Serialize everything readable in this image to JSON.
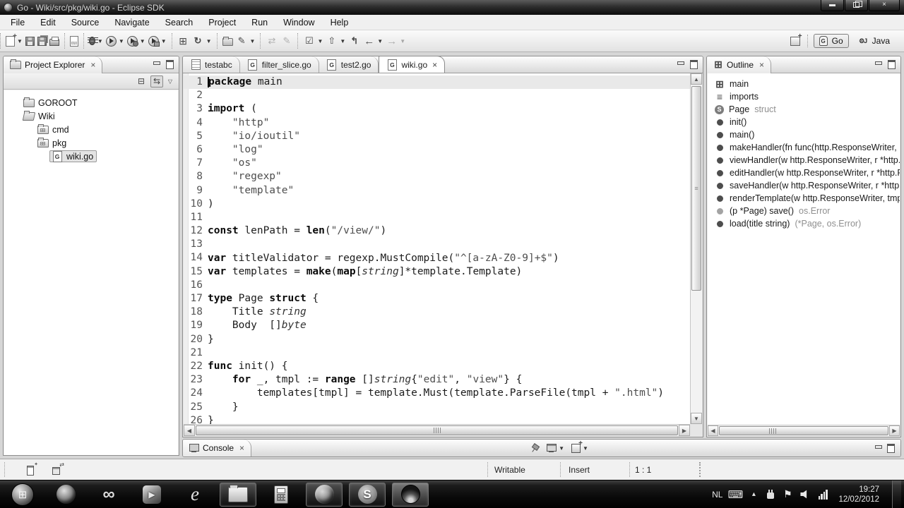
{
  "window": {
    "title": "Go - Wiki/src/pkg/wiki.go - Eclipse SDK",
    "controls": {
      "minimize": "minimize",
      "restore": "restore",
      "close": "×"
    }
  },
  "menu": [
    "File",
    "Edit",
    "Source",
    "Navigate",
    "Search",
    "Project",
    "Run",
    "Window",
    "Help"
  ],
  "toolbar": {
    "groups": [
      {
        "items": [
          {
            "icon": "new-wizard",
            "dd": true
          },
          {
            "icon": "save"
          },
          {
            "icon": "save-all"
          },
          {
            "icon": "print"
          }
        ]
      },
      {
        "items": [
          {
            "icon": "binary-file"
          }
        ]
      },
      {
        "items": [
          {
            "icon": "debug",
            "dd": true
          },
          {
            "icon": "run",
            "dd": true
          },
          {
            "icon": "run-history",
            "dd": true
          },
          {
            "icon": "run-config",
            "dd": true
          }
        ]
      },
      {
        "items": [
          {
            "icon": "build-all"
          },
          {
            "icon": "external-tools",
            "dd": true
          }
        ]
      },
      {
        "items": [
          {
            "icon": "open-resource"
          },
          {
            "icon": "mark-occurrences",
            "dd": true
          }
        ]
      },
      {
        "items": [
          {
            "icon": "refresh",
            "disabled": true
          },
          {
            "icon": "clean",
            "disabled": true
          }
        ]
      },
      {
        "items": [
          {
            "icon": "show-tasks",
            "dd": true
          },
          {
            "icon": "navigate-up",
            "dd": true
          },
          {
            "icon": "last-edit-location"
          },
          {
            "icon": "back",
            "dd": true
          },
          {
            "icon": "forward",
            "dd": true,
            "disabled": true
          }
        ]
      }
    ],
    "perspectives": [
      {
        "label": "Go",
        "icon": "go-perspective",
        "active": true
      },
      {
        "label": "Java",
        "icon": "java-perspective",
        "active": false
      }
    ]
  },
  "project_explorer": {
    "title": "Project Explorer",
    "tree": [
      {
        "label": "GOROOT",
        "icon": "folder",
        "indent": 0
      },
      {
        "label": "Wiki",
        "icon": "folder-open",
        "indent": 0
      },
      {
        "label": "cmd",
        "icon": "package-folder",
        "indent": 1
      },
      {
        "label": "pkg",
        "icon": "package-folder",
        "indent": 1
      },
      {
        "label": "wiki.go",
        "icon": "go-file",
        "indent": 2,
        "selected": true
      }
    ]
  },
  "editor": {
    "tabs": [
      {
        "label": "testabc",
        "icon": "text-file"
      },
      {
        "label": "filter_slice.go",
        "icon": "go-file"
      },
      {
        "label": "test2.go",
        "icon": "go-file"
      },
      {
        "label": "wiki.go",
        "icon": "go-file",
        "active": true,
        "close": "×"
      }
    ],
    "lines": [
      {
        "n": 1,
        "hl": true,
        "caret": true,
        "tokens": [
          [
            "package",
            "k"
          ],
          [
            " main",
            "p"
          ]
        ]
      },
      {
        "n": 2,
        "tokens": []
      },
      {
        "n": 3,
        "tokens": [
          [
            "import",
            "k"
          ],
          [
            " (",
            "p"
          ]
        ]
      },
      {
        "n": 4,
        "tokens": [
          [
            "    ",
            "p"
          ],
          [
            "\"http\"",
            "s"
          ]
        ]
      },
      {
        "n": 5,
        "tokens": [
          [
            "    ",
            "p"
          ],
          [
            "\"io/ioutil\"",
            "s"
          ]
        ]
      },
      {
        "n": 6,
        "tokens": [
          [
            "    ",
            "p"
          ],
          [
            "\"log\"",
            "s"
          ]
        ]
      },
      {
        "n": 7,
        "tokens": [
          [
            "    ",
            "p"
          ],
          [
            "\"os\"",
            "s"
          ]
        ]
      },
      {
        "n": 8,
        "tokens": [
          [
            "    ",
            "p"
          ],
          [
            "\"regexp\"",
            "s"
          ]
        ]
      },
      {
        "n": 9,
        "tokens": [
          [
            "    ",
            "p"
          ],
          [
            "\"template\"",
            "s"
          ]
        ]
      },
      {
        "n": 10,
        "tokens": [
          [
            ")",
            "p"
          ]
        ]
      },
      {
        "n": 11,
        "tokens": []
      },
      {
        "n": 12,
        "tokens": [
          [
            "const",
            "k"
          ],
          [
            " lenPath = ",
            "p"
          ],
          [
            "len",
            "k"
          ],
          [
            "(",
            "p"
          ],
          [
            "\"/view/\"",
            "s"
          ],
          [
            ")",
            "p"
          ]
        ]
      },
      {
        "n": 13,
        "tokens": []
      },
      {
        "n": 14,
        "tokens": [
          [
            "var",
            "k"
          ],
          [
            " titleValidator = regexp.MustCompile(",
            "p"
          ],
          [
            "\"^[a-zA-Z0-9]+$\"",
            "s"
          ],
          [
            ")",
            "p"
          ]
        ]
      },
      {
        "n": 15,
        "tokens": [
          [
            "var",
            "k"
          ],
          [
            " templates = ",
            "p"
          ],
          [
            "make",
            "k"
          ],
          [
            "(",
            "p"
          ],
          [
            "map",
            "k"
          ],
          [
            "[",
            "p"
          ],
          [
            "string",
            "t"
          ],
          [
            "]*template.Template)",
            "p"
          ]
        ]
      },
      {
        "n": 16,
        "tokens": []
      },
      {
        "n": 17,
        "tokens": [
          [
            "type",
            "k"
          ],
          [
            " Page ",
            "p"
          ],
          [
            "struct",
            "k"
          ],
          [
            " {",
            "p"
          ]
        ]
      },
      {
        "n": 18,
        "tokens": [
          [
            "    Title ",
            "p"
          ],
          [
            "string",
            "t"
          ]
        ]
      },
      {
        "n": 19,
        "tokens": [
          [
            "    Body  []",
            "p"
          ],
          [
            "byte",
            "t"
          ]
        ]
      },
      {
        "n": 20,
        "tokens": [
          [
            "}",
            "p"
          ]
        ]
      },
      {
        "n": 21,
        "tokens": []
      },
      {
        "n": 22,
        "tokens": [
          [
            "func",
            "k"
          ],
          [
            " init() {",
            "p"
          ]
        ]
      },
      {
        "n": 23,
        "tokens": [
          [
            "    ",
            "p"
          ],
          [
            "for",
            "k"
          ],
          [
            " _, tmpl := ",
            "p"
          ],
          [
            "range",
            "k"
          ],
          [
            " []",
            "p"
          ],
          [
            "string",
            "t"
          ],
          [
            "{",
            "p"
          ],
          [
            "\"edit\"",
            "s"
          ],
          [
            ", ",
            "p"
          ],
          [
            "\"view\"",
            "s"
          ],
          [
            "} {",
            "p"
          ]
        ]
      },
      {
        "n": 24,
        "tokens": [
          [
            "        templates[tmpl] = template.Must(template.ParseFile(tmpl + ",
            "p"
          ],
          [
            "\".html\"",
            "s"
          ],
          [
            ")",
            "p"
          ]
        ]
      },
      {
        "n": 25,
        "tokens": [
          [
            "    }",
            "p"
          ]
        ]
      },
      {
        "n": 26,
        "tokens": [
          [
            "}",
            "p"
          ]
        ]
      }
    ]
  },
  "outline": {
    "title": "Outline",
    "items": [
      {
        "icon": "main",
        "label": "main",
        "suffix": ""
      },
      {
        "icon": "imports",
        "label": "imports",
        "suffix": ""
      },
      {
        "icon": "struct",
        "label": "Page",
        "suffix": "struct"
      },
      {
        "icon": "func",
        "label": "init()",
        "suffix": ""
      },
      {
        "icon": "func",
        "label": "main()",
        "suffix": ""
      },
      {
        "icon": "func",
        "label": "makeHandler(fn func(http.ResponseWriter,",
        "suffix": ""
      },
      {
        "icon": "func",
        "label": "viewHandler(w http.ResponseWriter, r *http.",
        "suffix": ""
      },
      {
        "icon": "func",
        "label": "editHandler(w http.ResponseWriter, r *http.R",
        "suffix": ""
      },
      {
        "icon": "func",
        "label": "saveHandler(w http.ResponseWriter, r *http.",
        "suffix": ""
      },
      {
        "icon": "func",
        "label": "renderTemplate(w http.ResponseWriter, tmp",
        "suffix": ""
      },
      {
        "icon": "func-gray",
        "label": "(p *Page) save()",
        "suffix": "os.Error"
      },
      {
        "icon": "func",
        "label": "load(title string)",
        "suffix": "(*Page, os.Error)"
      }
    ]
  },
  "console": {
    "title": "Console",
    "toolbar": [
      {
        "icon": "pin-console"
      },
      {
        "icon": "display-selected-console",
        "dd": true
      },
      {
        "icon": "open-console",
        "dd": true
      }
    ]
  },
  "status_bar": {
    "writable": "Writable",
    "input_mode": "Insert",
    "caret_position": "1 : 1"
  },
  "taskbar": {
    "apps": [
      {
        "name": "start"
      },
      {
        "name": "network-globe"
      },
      {
        "name": "infinity-app"
      },
      {
        "name": "media-player"
      },
      {
        "name": "internet-explorer"
      },
      {
        "name": "file-explorer",
        "open": true
      },
      {
        "name": "calculator"
      },
      {
        "name": "firefox",
        "open": true
      },
      {
        "name": "skype",
        "open": true
      },
      {
        "name": "eclipse",
        "open": true,
        "active": true
      }
    ],
    "tray": {
      "language": "NL",
      "icons": [
        "keyboard",
        "hidden-icons",
        "power",
        "action-center",
        "volume",
        "network"
      ],
      "time": "19:27",
      "date": "12/02/2012"
    }
  }
}
